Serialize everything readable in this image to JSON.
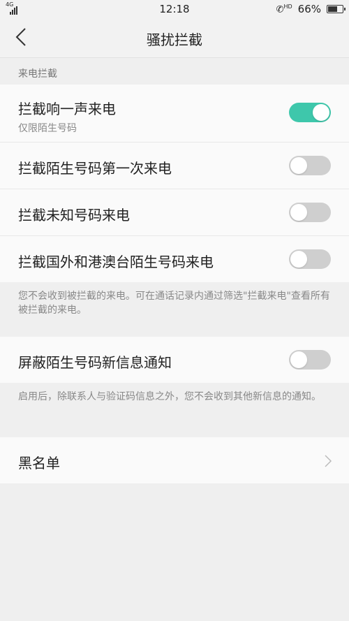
{
  "status_bar": {
    "network": "4G",
    "time": "12:18",
    "call_icon_text": "HD",
    "battery": "66%",
    "battery_level": 0.66
  },
  "nav": {
    "title": "骚扰拦截",
    "back_icon": "back-icon"
  },
  "call_section": {
    "header": "来电拦截",
    "rows": [
      {
        "label": "拦截响一声来电",
        "sublabel": "仅限陌生号码",
        "enabled": true
      },
      {
        "label": "拦截陌生号码第一次来电",
        "enabled": false
      },
      {
        "label": "拦截未知号码来电",
        "enabled": false
      },
      {
        "label": "拦截国外和港澳台陌生号码来电",
        "enabled": false
      }
    ],
    "note": "您不会收到被拦截的来电。可在通话记录内通过筛选\"拦截来电\"查看所有被拦截的来电。"
  },
  "message_section": {
    "rows": [
      {
        "label": "屏蔽陌生号码新信息通知",
        "enabled": false
      }
    ],
    "note": "启用后，除联系人与验证码信息之外，您不会收到其他新信息的通知。"
  },
  "blacklist": {
    "label": "黑名单",
    "chevron_icon": "chevron-right-icon"
  },
  "colors": {
    "toggle_on": "#3ec7ab",
    "toggle_off": "#cfcfcf",
    "background": "#efefef"
  }
}
